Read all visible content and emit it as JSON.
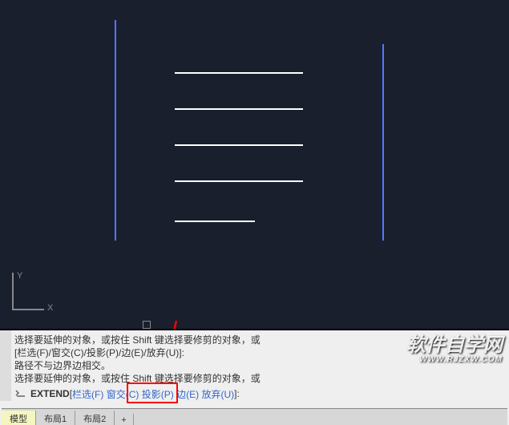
{
  "ucs": {
    "x_label": "X",
    "y_label": "Y"
  },
  "command_history": {
    "line1_a": "选择要延伸的对象，或按住 ",
    "line1_shift": "Shift",
    "line1_b": " 键选择要修剪的对象，或",
    "line2": "[栏选(F)/窗交(C)/投影(P)/边(E)/放弃(U)]:",
    "line3": "路径不与边界边相交。",
    "line4_a": "选择要延伸的对象，或按住 ",
    "line4_shift": "Shift",
    "line4_b": " 键选择要修剪的对象，或"
  },
  "command_line": {
    "prompt": "EXTEND",
    "open": " [",
    "close": "]:",
    "opts": {
      "fence_label": "栏选",
      "fence_key": "(F)",
      "crossing_label": "窗交",
      "crossing_key": "(C)",
      "project_label": "投影",
      "project_key": "(P)",
      "edge_label": "边",
      "edge_key": "(E)",
      "undo_label": "放弃",
      "undo_key": "(U)"
    }
  },
  "tabs": {
    "model": "模型",
    "layout1": "布局1",
    "layout2": "布局2",
    "plus": "+"
  },
  "watermark": {
    "title": "软件自学网",
    "url": "WWW.RJZXW.COM"
  },
  "icons": {
    "ucs": "ucs-icon",
    "cmd": "command-icon",
    "arrow": "annotation-arrow"
  }
}
